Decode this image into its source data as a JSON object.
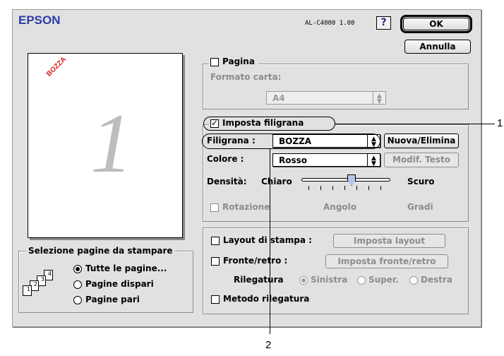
{
  "header": {
    "brand": "EPSON",
    "model": "AL-C4000 1.00",
    "help_label": "?",
    "ok_label": "OK",
    "cancel_label": "Annulla"
  },
  "preview": {
    "watermark_text": "BOZZA",
    "page_number": "1"
  },
  "page_selection": {
    "title": "Selezione pagine da stampare",
    "icon_pages": [
      "1",
      "2",
      "3",
      "4"
    ],
    "options": [
      {
        "label": "Tutte le pagine...",
        "selected": true
      },
      {
        "label": "Pagine dispari",
        "selected": false
      },
      {
        "label": "Pagine pari",
        "selected": false
      }
    ]
  },
  "paper_group": {
    "checkbox_label": "Pagina",
    "checked": false,
    "format_label": "Formato carta:",
    "format_value": "A4"
  },
  "watermark_group": {
    "checkbox_label": "Imposta filigrana",
    "checked": true,
    "filigrana_label": "Filigrana :",
    "filigrana_value": "BOZZA",
    "new_delete_label": "Nuova/Elimina",
    "color_label": "Colore :",
    "color_value": "Rosso",
    "modify_text_label": "Modif. Testo",
    "density_label": "Densità:",
    "density_light": "Chiaro",
    "density_dark": "Scuro",
    "density_level": 0.57,
    "rotation_label": "Rotazione",
    "rotation_checked": false,
    "angle_label": "Angolo",
    "degrees_label": "Gradi"
  },
  "layout_group": {
    "layout_label": "Layout di stampa :",
    "layout_button": "Imposta layout",
    "duplex_label": "Fronte/retro :",
    "duplex_button": "Imposta fronte/retro",
    "binding_label": "Rilegatura",
    "binding_options": [
      {
        "label": "Sinistra",
        "selected": true
      },
      {
        "label": "Super.",
        "selected": false
      },
      {
        "label": "Destra",
        "selected": false
      }
    ],
    "binding_method_label": "Metodo rilegatura"
  },
  "callouts": {
    "one": "1",
    "two": "2"
  }
}
